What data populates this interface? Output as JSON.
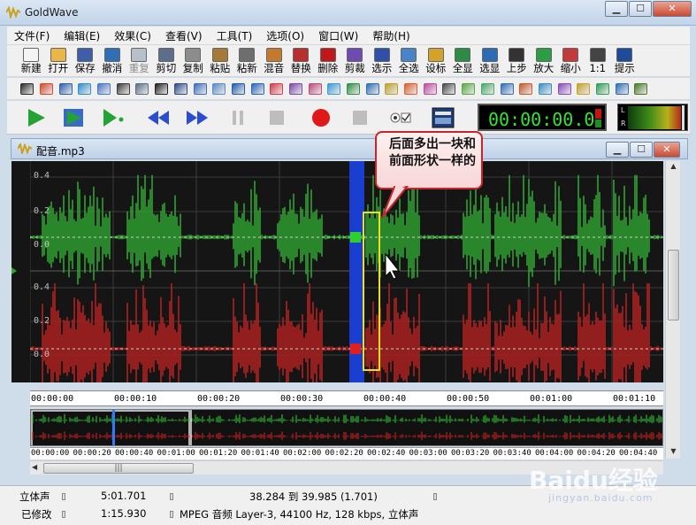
{
  "app": {
    "title": "GoldWave",
    "min_label": "▁",
    "max_label": "☐",
    "close_label": "✕"
  },
  "menu": [
    "文件(F)",
    "编辑(E)",
    "效果(C)",
    "查看(V)",
    "工具(T)",
    "选项(O)",
    "窗口(W)",
    "帮助(H)"
  ],
  "toolbar": [
    {
      "label": "新建",
      "icon": "new-icon",
      "color": "#f4f4f4",
      "enabled": true
    },
    {
      "label": "打开",
      "icon": "open-icon",
      "color": "#e8b748",
      "enabled": true
    },
    {
      "label": "保存",
      "icon": "save-icon",
      "color": "#3e5ea8",
      "enabled": true
    },
    {
      "label": "撤消",
      "icon": "undo-icon",
      "color": "#2f6fb5",
      "enabled": true
    },
    {
      "label": "重复",
      "icon": "redo-icon",
      "color": "#b7bfc9",
      "enabled": false
    },
    {
      "label": "剪切",
      "icon": "cut-icon",
      "color": "#5b6f8b",
      "enabled": true
    },
    {
      "label": "复制",
      "icon": "copy-icon",
      "color": "#8c8c8c",
      "enabled": true
    },
    {
      "label": "粘贴",
      "icon": "paste-icon",
      "color": "#a57a36",
      "enabled": true
    },
    {
      "label": "粘新",
      "icon": "paste-new-icon",
      "color": "#6e6e6e",
      "enabled": true
    },
    {
      "label": "混音",
      "icon": "mix-icon",
      "color": "#c47a2e",
      "enabled": true
    },
    {
      "label": "替换",
      "icon": "replace-icon",
      "color": "#b82f2f",
      "enabled": true
    },
    {
      "label": "删除",
      "icon": "delete-icon",
      "color": "#c01818",
      "enabled": true
    },
    {
      "label": "剪裁",
      "icon": "trim-icon",
      "color": "#6d4bb0",
      "enabled": true
    },
    {
      "label": "选示",
      "icon": "show-selection-icon",
      "color": "#2f4fa8",
      "enabled": true
    },
    {
      "label": "全选",
      "icon": "select-all-icon",
      "color": "#4b83c8",
      "enabled": true
    },
    {
      "label": "设标",
      "icon": "set-marker-icon",
      "color": "#d3a22d",
      "enabled": true
    },
    {
      "label": "全显",
      "icon": "zoom-all-icon",
      "color": "#2c8c45",
      "enabled": true
    },
    {
      "label": "选显",
      "icon": "zoom-selection-icon",
      "color": "#2d6cb2",
      "enabled": true
    },
    {
      "label": "上步",
      "icon": "previous-zoom-icon",
      "color": "#333333",
      "enabled": true
    },
    {
      "label": "放大",
      "icon": "zoom-in-icon",
      "color": "#2c9c45",
      "enabled": true
    },
    {
      "label": "缩小",
      "icon": "zoom-out-icon",
      "color": "#c23a3a",
      "enabled": true
    },
    {
      "label": "1:1",
      "icon": "zoom-actual-icon",
      "color": "#444444",
      "enabled": true
    },
    {
      "label": "提示",
      "icon": "hint-icon",
      "color": "#1f4c9a",
      "enabled": true
    }
  ],
  "effects_toolbar": [
    {
      "icon": "fade-in-icon",
      "color": "#2d2d2d"
    },
    {
      "icon": "auto-gain-icon",
      "color": "#d64a2b"
    },
    {
      "icon": "compressor-icon",
      "color": "#2f5fb3"
    },
    {
      "icon": "doppler-icon",
      "color": "#2f8fd0"
    },
    {
      "icon": "dynamics-icon",
      "color": "#4a78c8"
    },
    {
      "icon": "echo-icon",
      "color": "#3b3b3b"
    },
    {
      "icon": "equalizer-icon",
      "color": "#5a6e88"
    },
    {
      "icon": "filter-icon",
      "color": "#222222"
    },
    {
      "icon": "invert-icon",
      "color": "#2d4b8a"
    },
    {
      "icon": "mechanize-icon",
      "color": "#3d6fc0"
    },
    {
      "icon": "noise-reduction-icon",
      "color": "#5a8cc8"
    },
    {
      "icon": "offset-icon",
      "color": "#1f5fb0"
    },
    {
      "icon": "pan-icon",
      "color": "#2b67b8"
    },
    {
      "icon": "pitch-icon",
      "color": "#d53a4a"
    },
    {
      "icon": "resample-icon",
      "color": "#7c4aa8"
    },
    {
      "icon": "reverb-icon",
      "color": "#c04a7a"
    },
    {
      "icon": "reverse-icon",
      "color": "#3b9ad8"
    },
    {
      "icon": "silence-icon",
      "color": "#2f8f45"
    },
    {
      "icon": "stereo-icon",
      "color": "#2f6fb8"
    },
    {
      "icon": "time-warp-icon",
      "color": "#c0a02b"
    },
    {
      "icon": "volume-icon",
      "color": "#e0602b"
    },
    {
      "icon": "shape-icon",
      "color": "#c04aa0"
    },
    {
      "icon": "match-icon",
      "color": "#4a4a4a"
    },
    {
      "icon": "balance-icon",
      "color": "#5aa843"
    },
    {
      "icon": "channel-icon",
      "color": "#4aa86a"
    },
    {
      "icon": "cue-icon",
      "color": "#2f6fb8"
    },
    {
      "icon": "level-icon",
      "color": "#c85a2b"
    },
    {
      "icon": "spectrum-icon",
      "color": "#3b8fc8"
    },
    {
      "icon": "envelope-icon",
      "color": "#8a4ac0"
    },
    {
      "icon": "flange-icon",
      "color": "#c8a02b"
    },
    {
      "icon": "stretch-icon",
      "color": "#2f9f5a"
    },
    {
      "icon": "hz-icon",
      "color": "#2f6fb8"
    },
    {
      "icon": "settings-effect-icon",
      "color": "#4a7a2b"
    }
  ],
  "transport": {
    "time": "00:00:00.0",
    "meter_labels": [
      "L",
      "R"
    ],
    "play_color": "#24a233",
    "rewind_color": "#2a4ecf",
    "record_color": "#e01818"
  },
  "document": {
    "title": "配音.mp3"
  },
  "channels": [
    {
      "name": "left",
      "color": "#2fa32f",
      "y_ticks": [
        "0.4",
        "0.2",
        "0.0"
      ]
    },
    {
      "name": "right",
      "color": "#b22020",
      "y_ticks": [
        "0.4",
        "0.2",
        "0.0"
      ]
    }
  ],
  "timeline_ticks": [
    "00:00:00",
    "00:00:10",
    "00:00:20",
    "00:00:30",
    "00:00:40",
    "00:00:50",
    "00:01:00",
    "00:01:10"
  ],
  "overview_ticks": [
    "00:00:00",
    "00:00:20",
    "00:00:40",
    "00:01:00",
    "00:01:20",
    "00:01:40",
    "00:02:00",
    "00:02:20",
    "00:02:40",
    "00:03:00",
    "00:03:20",
    "00:03:40",
    "00:04:00",
    "00:04:20",
    "00:04:40"
  ],
  "annotation": {
    "text": "后面多出一块和前面形状一样的",
    "border_color": "#c6262b",
    "box_color": "#e8e020"
  },
  "status": {
    "channel_mode": "立体声",
    "length": "5:01.701",
    "selection": "38.284 到 39.985 (1.701)",
    "modified": "已修改",
    "position": "1:15.930",
    "format": "MPEG 音频 Layer-3, 44100 Hz, 128 kbps, 立体声"
  },
  "watermark": {
    "text": "Baidu经验",
    "sub": "jingyan.baidu.com"
  }
}
